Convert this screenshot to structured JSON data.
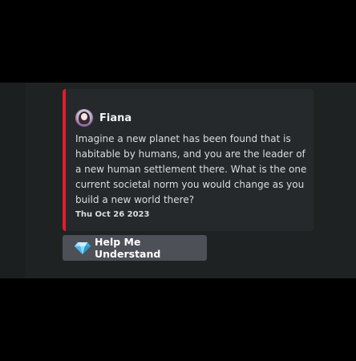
{
  "embed": {
    "author_name": "Fiana",
    "description": "Imagine a new planet has been found that is habitable by humans, and you are the leader of a new human settlement there. What is the one current societal norm you would change as you build a new world there?",
    "footer_date": "Thu Oct 26 2023",
    "accent_color": "#e21d2b"
  },
  "action": {
    "button_label": "Help Me Understand",
    "icon": "gem-icon"
  }
}
